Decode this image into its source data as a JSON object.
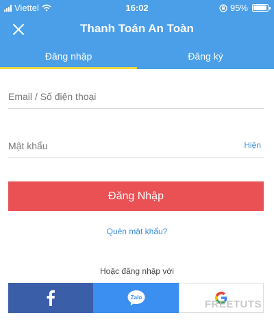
{
  "status_bar": {
    "carrier": "Viettel",
    "time": "16:02",
    "battery": "95%"
  },
  "header": {
    "title": "Thanh Toán An Toàn",
    "tabs": [
      {
        "label": "Đăng nhập",
        "active": true
      },
      {
        "label": "Đăng ký",
        "active": false
      }
    ]
  },
  "form": {
    "email_placeholder": "Email / Số điện thoại",
    "password_placeholder": "Mật khẩu",
    "show_label": "Hiện",
    "login_label": "Đăng Nhập",
    "forgot_label": "Quên mật khẩu?",
    "or_label": "Hoặc đăng nhập với"
  },
  "social": {
    "facebook_icon": "facebook-icon",
    "zalo_label": "Zalo",
    "google_icon": "google-icon"
  },
  "watermark": "FREETUTS",
  "colors": {
    "header": "#4a9fe8",
    "tab_indicator": "#f4d742",
    "login_button": "#e95155",
    "link": "#3b8ee0",
    "facebook": "#3b5ea8",
    "zalo": "#3a8ff0"
  }
}
